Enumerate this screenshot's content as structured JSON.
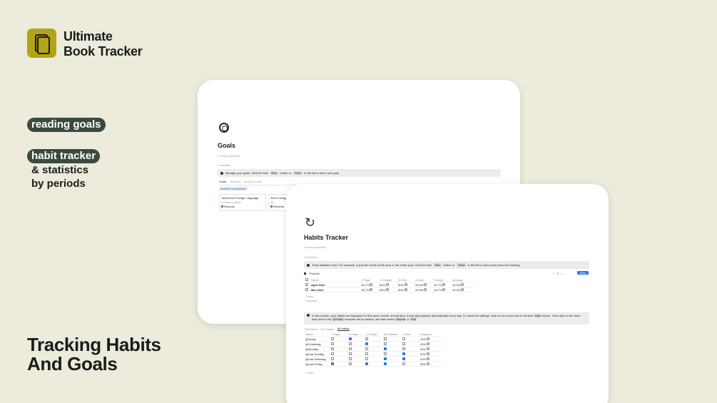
{
  "brand": {
    "line1": "Ultimate",
    "line2": "Book Tracker",
    "accent_color": "#b3a319",
    "logo_icon": "book-icon"
  },
  "features": {
    "pill1": "reading goals",
    "pill2": "habit tracker",
    "sub1": "& statistics",
    "sub2": "by periods",
    "pill_color": "#3b4a3f"
  },
  "headline": {
    "line1": "Tracking Habits",
    "line2": "And Goals"
  },
  "goals_page": {
    "icon": "target-icon",
    "title": "Goals",
    "properties_toggle": "3 more properties",
    "backlinks": "1 backlink",
    "callout": {
      "before": "Manage your goals. Click the blue",
      "kbd1": "New",
      "middle": "button or",
      "kbd2": "+New",
      "after": "in the list to add a new goal"
    },
    "tabs": [
      "Goals",
      "Records",
      "Archive Goals"
    ],
    "chip": "Archive: Unchecked",
    "cards": [
      {
        "title": "Total Book Foreign Language",
        "line1": "0 books readed",
        "tag": "Records"
      },
      {
        "title": "2024 Foreign",
        "line1": "48",
        "tag": "Records"
      }
    ]
  },
  "habits_page": {
    "icon": "refresh-icon",
    "title": "Habits Tracker",
    "properties_toggle": "3 more properties",
    "backlinks": "1 backlink",
    "callout1": {
      "before": "Track statistics here. For example, a specific month of the year or the entire year. Click the blue",
      "kbd1": "New",
      "middle": "button or",
      "kbd2": "+New",
      "after": "in the list to add a new period for tracking"
    },
    "periods_view": "Periods",
    "new_button": "New",
    "periods_headers": [
      "Name",
      "1 Page",
      "1 Chapter",
      "30 Min",
      "1 Hour",
      "Foreign ...",
      "Average"
    ],
    "periods_rows": [
      {
        "name": "April 2024",
        "values": [
          "16.7%",
          "50%",
          "50%",
          "33.3%",
          "16.7%",
          "33.3%"
        ]
      },
      {
        "name": "Mar 2024",
        "values": [
          "16.7%",
          "50%",
          "50%",
          "33.3%",
          "16.7%",
          "33.3%"
        ]
      }
    ],
    "new_row": "+ New",
    "calculate": "Calculate",
    "callout2": {
      "before": "In this section, your habits are displayed for this week, month, and all time. A new day appears automatically every day. To check the settings, click on the arrow next to the blue",
      "kbd1": "New",
      "middle": "button. Then click on the three dots next to the",
      "kbd2": "@Today",
      "after": "template set by default.",
      "tail": "and then select",
      "kbd3": "Repeat",
      "or": "or",
      "kbd4": "Edit"
    },
    "habit_tabs": [
      "This Week",
      "This Month",
      "All Habits"
    ],
    "habits_headers": [
      "Name",
      "1 Page",
      "Foreign ...",
      "1 Chapter",
      "30 Minutes",
      "1 Hour",
      "Progress"
    ],
    "habits_rows": [
      {
        "name": "@Today",
        "checks": [
          false,
          true,
          false,
          false,
          false
        ],
        "progress": "20%"
      },
      {
        "name": "@Yesterday",
        "checks": [
          false,
          false,
          true,
          false,
          false
        ],
        "progress": "20%"
      },
      {
        "name": "@Monday",
        "checks": [
          false,
          false,
          false,
          true,
          false
        ],
        "progress": "20%"
      },
      {
        "name": "@Last Sunday",
        "checks": [
          false,
          false,
          false,
          false,
          true
        ],
        "progress": "20%"
      },
      {
        "name": "@Last Saturday",
        "checks": [
          false,
          false,
          false,
          true,
          true
        ],
        "progress": "40%"
      },
      {
        "name": "@Last Friday",
        "checks": [
          true,
          false,
          true,
          true,
          false
        ],
        "progress": "60%"
      }
    ]
  }
}
